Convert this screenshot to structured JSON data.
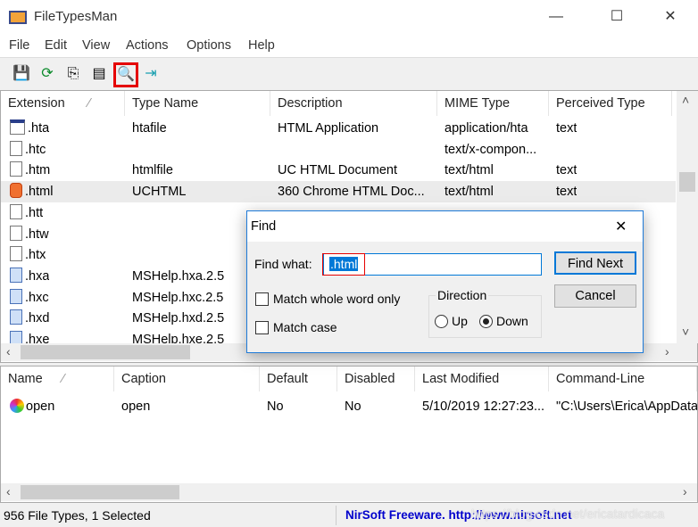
{
  "window": {
    "title": "FileTypesMan",
    "minimize": "—",
    "maximize": "☐",
    "close": "✕"
  },
  "menu": [
    "File",
    "Edit",
    "View",
    "Actions",
    "Options",
    "Help"
  ],
  "toolbar": [
    {
      "icon": "save-icon",
      "glyph": "💾"
    },
    {
      "icon": "refresh-icon",
      "glyph": "⟳"
    },
    {
      "icon": "copy-icon",
      "glyph": "⎘"
    },
    {
      "icon": "properties-icon",
      "glyph": "▤"
    },
    {
      "icon": "find-icon",
      "glyph": "🔍",
      "highlighted": true
    },
    {
      "icon": "exit-icon",
      "glyph": "⇥"
    }
  ],
  "file_types": {
    "columns": [
      "Extension",
      "Type Name",
      "Description",
      "MIME Type",
      "Perceived Type"
    ],
    "rows": [
      {
        "ext": ".hta",
        "type": "htafile",
        "desc": "HTML Application",
        "mime": "application/hta",
        "perceived": "text"
      },
      {
        "ext": ".htc",
        "type": "",
        "desc": "",
        "mime": "text/x-compon...",
        "perceived": ""
      },
      {
        "ext": ".htm",
        "type": "htmlfile",
        "desc": "UC HTML Document",
        "mime": "text/html",
        "perceived": "text"
      },
      {
        "ext": ".html",
        "type": "UCHTML",
        "desc": "360 Chrome HTML Doc...",
        "mime": "text/html",
        "perceived": "text",
        "selected": true
      },
      {
        "ext": ".htt",
        "type": "",
        "desc": "",
        "mime": "",
        "perceived": ""
      },
      {
        "ext": ".htw",
        "type": "",
        "desc": "",
        "mime": "",
        "perceived": ""
      },
      {
        "ext": ".htx",
        "type": "",
        "desc": "",
        "mime": "",
        "perceived": ""
      },
      {
        "ext": ".hxa",
        "type": "MSHelp.hxa.2.5",
        "desc": "",
        "mime": "",
        "perceived": ""
      },
      {
        "ext": ".hxc",
        "type": "MSHelp.hxc.2.5",
        "desc": "",
        "mime": "",
        "perceived": ""
      },
      {
        "ext": ".hxd",
        "type": "MSHelp.hxd.2.5",
        "desc": "",
        "mime": "",
        "perceived": ""
      },
      {
        "ext": ".hxe",
        "type": "MSHelp.hxe.2.5",
        "desc": "",
        "mime": "",
        "perceived": ""
      }
    ]
  },
  "actions": {
    "columns": [
      "Name",
      "Caption",
      "Default",
      "Disabled",
      "Last Modified",
      "Command-Line"
    ],
    "rows": [
      {
        "name": "open",
        "caption": "open",
        "default": "No",
        "disabled": "No",
        "modified": "5/10/2019 12:27:23...",
        "cmd": "\"C:\\Users\\Erica\\AppData"
      }
    ]
  },
  "status": {
    "left": "956 File Types, 1 Selected",
    "right": "NirSoft Freeware.  http://www.nirsoft.net",
    "watermark": "https://blog.csdn.net/ericatardicaca"
  },
  "find_dialog": {
    "title": "Find",
    "close": "✕",
    "find_what_label": "Find what:",
    "find_what_value": ".html",
    "match_whole_word": "Match whole word only",
    "match_case": "Match case",
    "direction_label": "Direction",
    "up": "Up",
    "down": "Down",
    "direction_selected": "Down",
    "find_next": "Find Next",
    "cancel": "Cancel"
  },
  "colors": {
    "accent": "#1e7ad8",
    "highlight": "#e50000",
    "selection": "#0078d7",
    "link": "#0000cc"
  }
}
